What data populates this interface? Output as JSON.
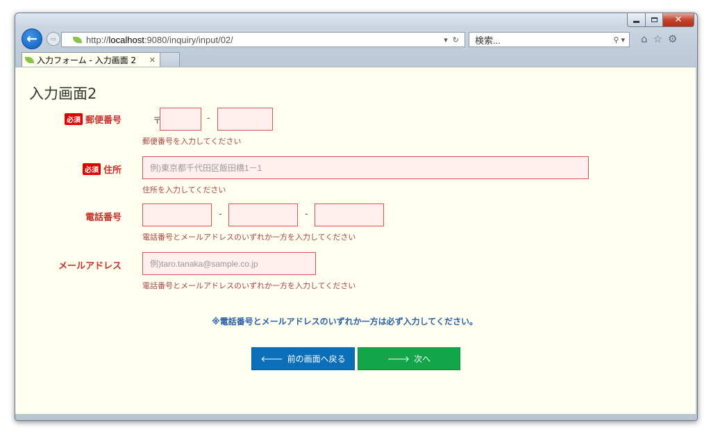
{
  "browser": {
    "url_prefix": "http://",
    "url_host": "localhost",
    "url_rest": ":9080/inquiry/input/02/",
    "search_placeholder": "検索...",
    "tab_title": "入力フォーム - 入力画面 2"
  },
  "page": {
    "title": "入力画面2",
    "required_badge": "必須",
    "postal": {
      "label": "郵便番号",
      "prefix": "〒",
      "separator": "-",
      "error": "郵便番号を入力してください"
    },
    "address": {
      "label": "住所",
      "placeholder": "例)東京都千代田区飯田橋1－1",
      "error": "住所を入力してください"
    },
    "phone": {
      "label": "電話番号",
      "separator": "-",
      "error": "電話番号とメールアドレスのいずれか一方を入力してください"
    },
    "email": {
      "label": "メールアドレス",
      "placeholder": "例)taro.tanaka@sample.co.jp",
      "error": "電話番号とメールアドレスのいずれか一方を入力してください"
    },
    "note": "※電話番号とメールアドレスのいずれか一方は必ず入力してください。",
    "back_button": "前の画面へ戻る",
    "next_button": "次へ"
  },
  "colors": {
    "required_label": "#c9302c",
    "error_text": "#a94442",
    "error_border": "#d9534f",
    "page_background": "#fffff0",
    "back_button": "#0a6fb8",
    "next_button": "#12a54a",
    "note_text": "#2a5ea8"
  }
}
